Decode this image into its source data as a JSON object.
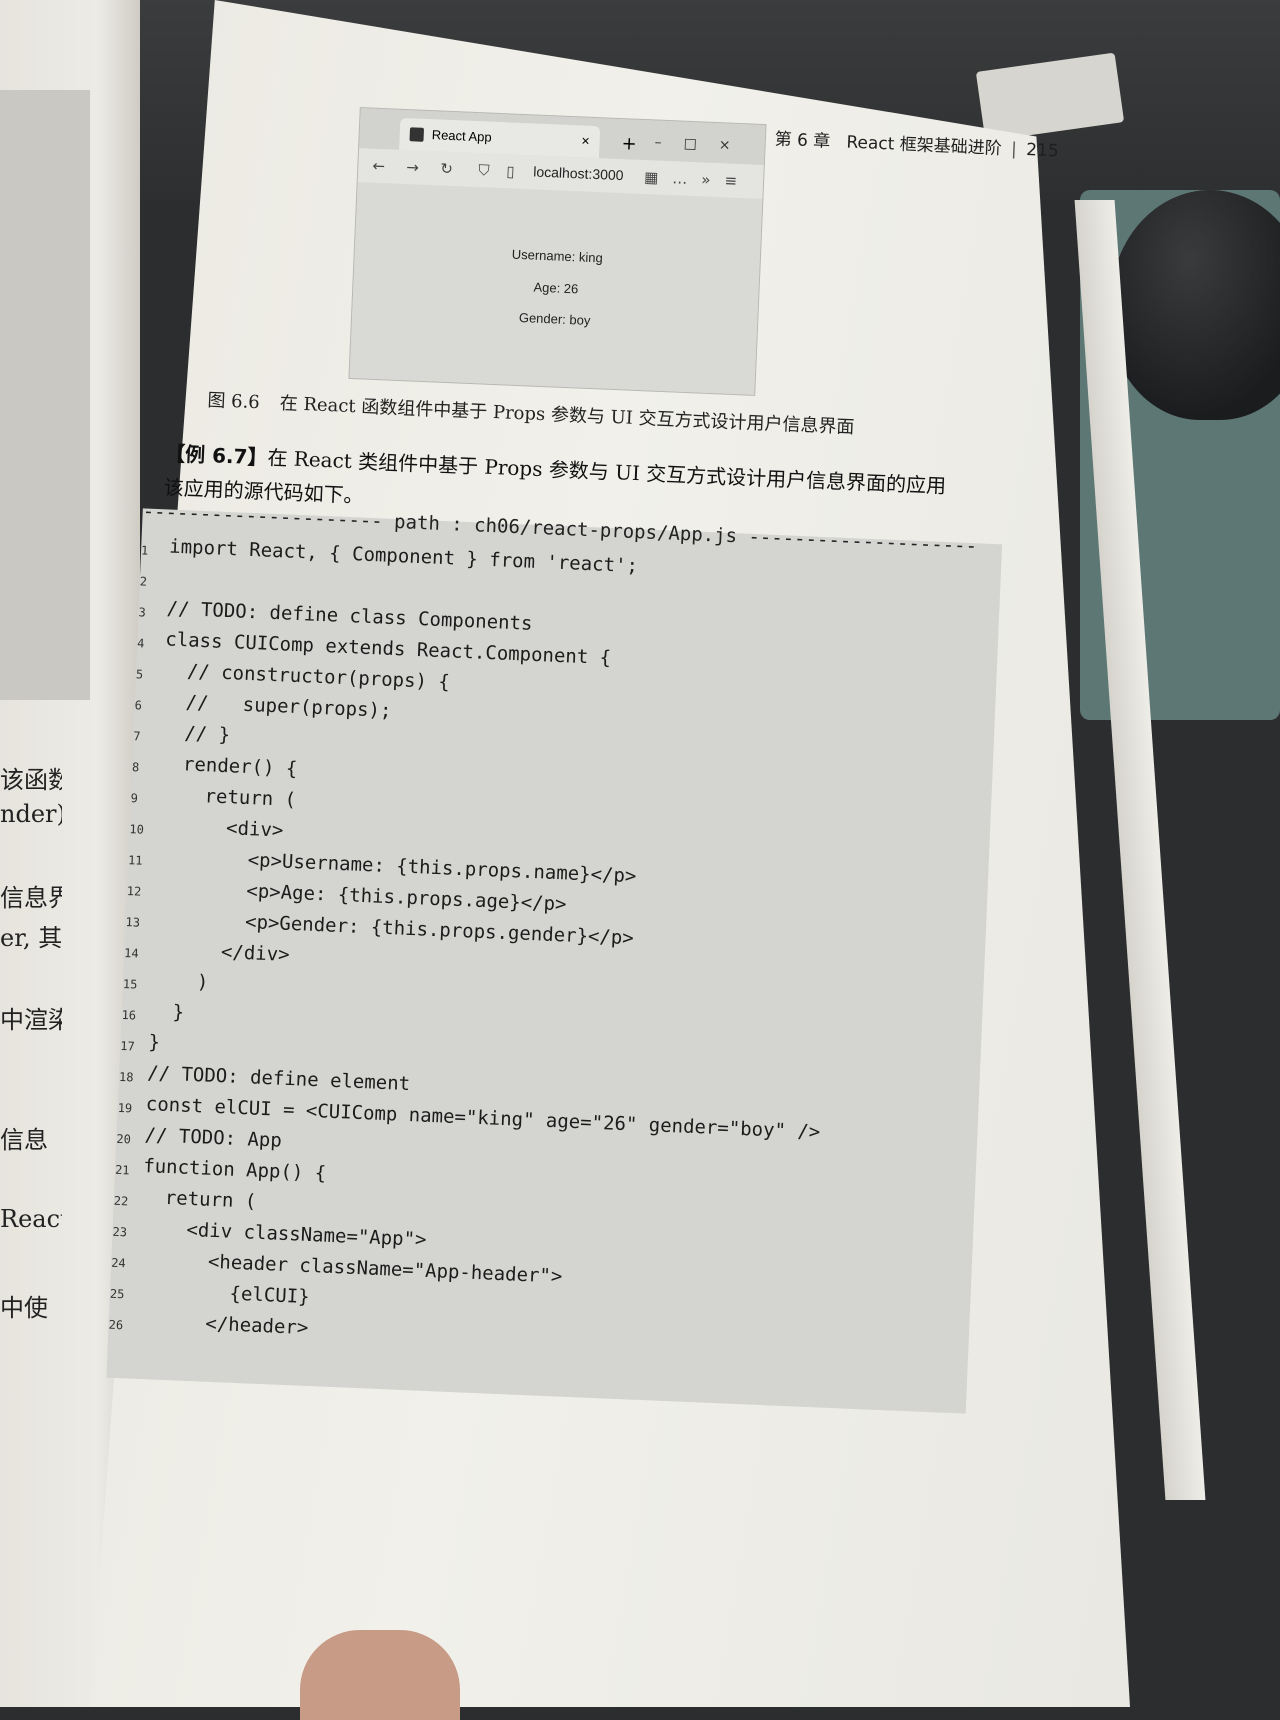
{
  "running_head": {
    "chapter": "第 6 章",
    "title": "React 框架基础进阶",
    "page": "215"
  },
  "figure": {
    "tab_title": "React App",
    "url": "localhost:3000",
    "lines": [
      "Username: king",
      "Age: 26",
      "Gender: boy"
    ],
    "caption_number": "图 6.6",
    "caption_text": "在 React 函数组件中基于 Props 参数与 UI 交互方式设计用户信息界面"
  },
  "example": {
    "label": "【例 6.7】",
    "title": "在 React 类组件中基于 Props 参数与 UI 交互方式设计用户信息界面的应用",
    "intro": "该应用的源代码如下。"
  },
  "code": {
    "path_line": "--------------------- path : ch06/react-props/App.js --------------------",
    "lines": [
      {
        "n": "1",
        "t": "import React, { Component } from 'react';"
      },
      {
        "n": "2",
        "t": ""
      },
      {
        "n": "3",
        "t": "// TODO: define class Components"
      },
      {
        "n": "4",
        "t": "class CUIComp extends React.Component {"
      },
      {
        "n": "5",
        "t": "  // constructor(props) {"
      },
      {
        "n": "6",
        "t": "  //   super(props);"
      },
      {
        "n": "7",
        "t": "  // }"
      },
      {
        "n": "8",
        "t": "  render() {"
      },
      {
        "n": "9",
        "t": "    return ("
      },
      {
        "n": "10",
        "t": "      <div>"
      },
      {
        "n": "11",
        "t": "        <p>Username: {this.props.name}</p>"
      },
      {
        "n": "12",
        "t": "        <p>Age: {this.props.age}</p>"
      },
      {
        "n": "13",
        "t": "        <p>Gender: {this.props.gender}</p>"
      },
      {
        "n": "14",
        "t": "      </div>"
      },
      {
        "n": "15",
        "t": "    )"
      },
      {
        "n": "16",
        "t": "  }"
      },
      {
        "n": "17",
        "t": "}"
      },
      {
        "n": "18",
        "t": "// TODO: define element"
      },
      {
        "n": "19",
        "t": "const elCUI = <CUIComp name=\"king\" age=\"26\" gender=\"boy\" />"
      },
      {
        "n": "20",
        "t": "// TODO: App"
      },
      {
        "n": "21",
        "t": "function App() {"
      },
      {
        "n": "22",
        "t": "  return ("
      },
      {
        "n": "23",
        "t": "    <div className=\"App\">"
      },
      {
        "n": "24",
        "t": "      <header className=\"App-header\">"
      },
      {
        "n": "25",
        "t": "        {elCUI}"
      },
      {
        "n": "26",
        "t": "      </header>"
      }
    ]
  },
  "left_page_fragments": [
    "该函数",
    "nder),",
    "信息界",
    "er, 其",
    "中渲染",
    "信息",
    "React",
    "中使"
  ]
}
